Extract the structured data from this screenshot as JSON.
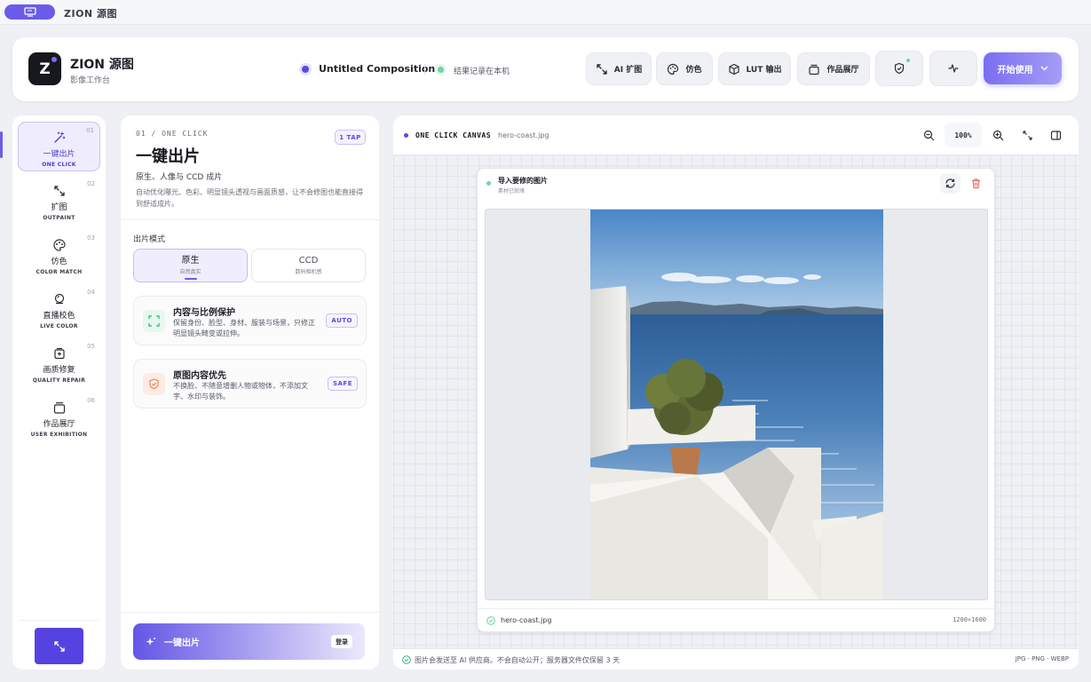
{
  "topbar": {
    "title": "ZION 源图"
  },
  "header": {
    "logo_letter": "Z",
    "brand": "ZION 源图",
    "brand_sub": "影像工作台",
    "composition": "Untitled Composition",
    "save_status": "结果记录在本机",
    "buttons": [
      {
        "label": "AI 扩图",
        "icon": "expand-icon"
      },
      {
        "label": "仿色",
        "icon": "palette-icon"
      },
      {
        "label": "LUT 输出",
        "icon": "cube-icon"
      },
      {
        "label": "作品展厅",
        "icon": "gallery-icon"
      }
    ],
    "cta": "开始使用"
  },
  "nav": {
    "items": [
      {
        "num": "01",
        "label": "一键出片",
        "en": "ONE CLICK",
        "icon": "magic-wand-icon",
        "active": true
      },
      {
        "num": "02",
        "label": "扩图",
        "en": "OUTPAINT",
        "icon": "expand-icon"
      },
      {
        "num": "03",
        "label": "仿色",
        "en": "COLOR MATCH",
        "icon": "palette-icon"
      },
      {
        "num": "04",
        "label": "直播校色",
        "en": "LIVE COLOR",
        "icon": "color-drop-icon"
      },
      {
        "num": "05",
        "label": "画质修复",
        "en": "QUALITY REPAIR",
        "icon": "repair-icon"
      },
      {
        "num": "06",
        "label": "作品展厅",
        "en": "USER EXHIBITION",
        "icon": "gallery-icon"
      }
    ]
  },
  "panel": {
    "step": "01 / ONE CLICK",
    "tap": "1 TAP",
    "title": "一键出片",
    "subtitle": "原生、人像与 CCD 成片",
    "desc": "自动优化曝光、色彩、明显镜头透视与画面质感，让不会修图也能直接得到舒适成片。",
    "mode_label": "出片模式",
    "modes": [
      {
        "label": "原生",
        "sub": "自然真实",
        "selected": true
      },
      {
        "label": "CCD",
        "sub": "数码相机感",
        "selected": false
      }
    ],
    "cards": [
      {
        "title": "内容与比例保护",
        "desc": "保留身份、脸型、身材、服装与场景，只修正明显镜头畸变或拉伸。",
        "tag": "AUTO",
        "icon": "frame-icon",
        "icon_color": "#35b37a"
      },
      {
        "title": "原图内容优先",
        "desc": "不换脸、不随意增删人物或物体，不添加文字、水印与装饰。",
        "tag": "SAFE",
        "icon": "shield-icon",
        "icon_color": "#e8825a"
      }
    ],
    "action": "一键出片",
    "action_badge": "登录"
  },
  "canvas": {
    "title": "ONE CLICK CANVAS",
    "file": "hero-coast.jpg",
    "zoom": "100%",
    "card_title": "导入要修的图片",
    "card_sub": "素材已就绪",
    "filename": "hero-coast.jpg",
    "dimensions": "1200×1600",
    "notice": "图片会发送至 AI 供应商。不会自动公开；服务器文件仅保留 3 天",
    "formats": "JPG · PNG · WEBP"
  },
  "colors": {
    "accent": "#6b5bea",
    "accent_dark": "#5642e0",
    "success": "#6fd4a3",
    "danger": "#e86a6a"
  }
}
